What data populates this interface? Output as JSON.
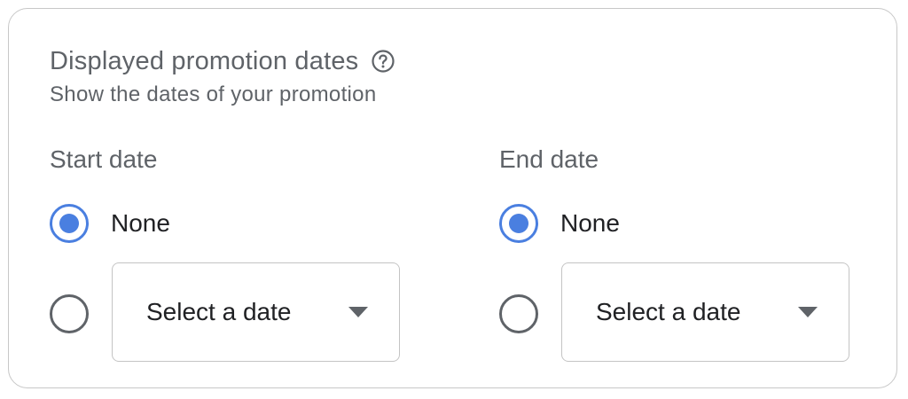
{
  "section": {
    "title": "Displayed promotion dates",
    "subtitle": "Show the dates of your promotion",
    "help_icon": "help-circle-icon"
  },
  "start_date": {
    "label": "Start date",
    "none_option": "None",
    "none_selected": true,
    "select_placeholder": "Select a date",
    "dropdown_icon": "caret-down-icon"
  },
  "end_date": {
    "label": "End date",
    "none_option": "None",
    "none_selected": true,
    "select_placeholder": "Select a date",
    "dropdown_icon": "caret-down-icon"
  },
  "colors": {
    "accent": "#4a7fe0",
    "secondary_text": "#5f6368",
    "primary_text": "#202124",
    "border": "#c7c7c7"
  }
}
